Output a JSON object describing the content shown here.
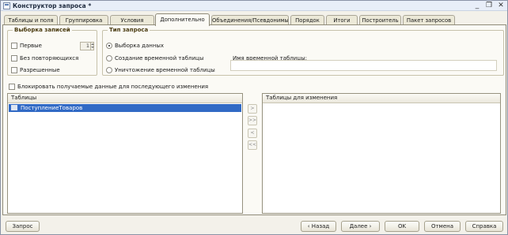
{
  "window": {
    "title": "Конструктор запроса *",
    "controls": {
      "minimize": "_",
      "restore": "❐",
      "close": "✕"
    }
  },
  "tabs": [
    "Таблицы и поля",
    "Группировка",
    "Условия",
    "Дополнительно",
    "Объединения/Псевдонимы",
    "Порядок",
    "Итоги",
    "Построитель",
    "Пакет запросов"
  ],
  "active_tab": "Дополнительно",
  "selection_group": {
    "title": "Выборка записей",
    "first_label": "Первые",
    "first_value": "1",
    "distinct_label": "Без повторяющихся",
    "allowed_label": "Разрешенные"
  },
  "query_type_group": {
    "title": "Тип запроса",
    "options": [
      {
        "label": "Выборка данных",
        "selected": true
      },
      {
        "label": "Создание временной таблицы",
        "selected": false
      },
      {
        "label": "Уничтожение временной таблицы",
        "selected": false
      }
    ],
    "temp_table_label": "Имя временной таблицы:",
    "temp_table_value": ""
  },
  "lock_checkbox_label": "Блокировать получаемые данные для последующего изменения",
  "tables_pane": {
    "header": "Таблицы",
    "rows": [
      "ПоступлениеТоваров"
    ]
  },
  "change_pane": {
    "header": "Таблицы для изменения",
    "rows": []
  },
  "move_buttons": [
    ">",
    ">>",
    "<",
    "<<"
  ],
  "footer": {
    "query_button": "Запрос",
    "back_button": "‹ Назад",
    "next_button": "Далее ›",
    "ok_button": "OK",
    "cancel_button": "Отмена",
    "help_button": "Справка"
  },
  "colors": {
    "selection": "#316ac5",
    "group_title": "#4a3b10",
    "panel_bg": "#fbfaf5"
  }
}
